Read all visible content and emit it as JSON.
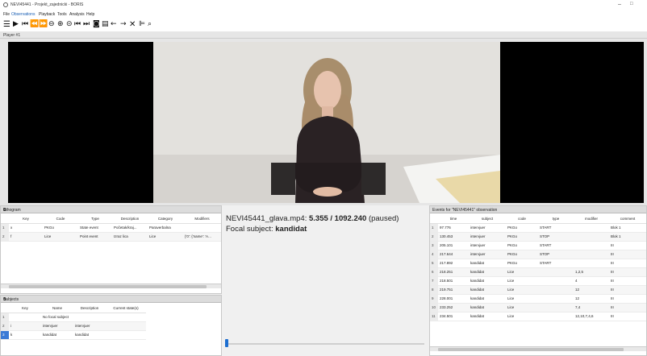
{
  "window": {
    "title": "NEVI45441 - Projekt_zajednicki - BORIS"
  },
  "menu": [
    "File",
    "Observations",
    "Playback",
    "Tools",
    "Analysis",
    "Help"
  ],
  "toolbar_icons": [
    "list-menu-icon",
    "play-icon",
    "skip-start-icon",
    "rewind-icon",
    "fast-forward-icon",
    "zoom-out-circle-icon",
    "zoom-in-circle-icon",
    "minus-circle-icon",
    "jump-back-icon",
    "jump-forward-icon",
    "camera-icon",
    "frame-icon",
    "arrow-left-icon",
    "arrow-right-icon",
    "close-x-icon",
    "align-icon",
    "search-icon"
  ],
  "player": {
    "label": "Player #1"
  },
  "ethogram": {
    "title": "Ethogram",
    "columns": [
      "Key",
      "Code",
      "Type",
      "Description",
      "Category",
      "Modifiers"
    ],
    "rows": [
      {
        "num": "1",
        "key": "x",
        "code": "PKGo",
        "type": "State event",
        "description": "Početak/kraj...",
        "category": "Paraverbalna",
        "modifiers": ""
      },
      {
        "num": "2",
        "key": "f",
        "code": "Lice",
        "type": "Point event",
        "description": "Izraz lica",
        "category": "Lice",
        "modifiers": "{'0': {'name': 'A..."
      }
    ]
  },
  "subjects": {
    "title": "Subjects",
    "columns": [
      "Key",
      "Name",
      "Description",
      "Current state(s)"
    ],
    "rows": [
      {
        "num": "1",
        "key": "",
        "name": "No focal subject",
        "description": "",
        "state": ""
      },
      {
        "num": "2",
        "key": "i",
        "name": "intervjuer",
        "description": "intervjuer",
        "state": ""
      },
      {
        "num": "3",
        "key": "k",
        "name": "kandidat",
        "description": "kandidat",
        "state": ""
      }
    ]
  },
  "info": {
    "media_prefix": "NEVI45441_glava.mp4: ",
    "time_current": "5.355 / 1092.240",
    "status": " (paused)",
    "focal_label": "Focal subject: ",
    "focal_value": "kandidat"
  },
  "playback_position": 0.005,
  "events": {
    "title": "Events for \"NEVI45441\" observation",
    "columns": [
      "time",
      "subject",
      "code",
      "type",
      "modifier",
      "comment"
    ],
    "rows": [
      {
        "num": "1",
        "time": "97.776",
        "subject": "intervjuer",
        "code": "PKGo",
        "type": "START",
        "modifier": "",
        "comment": "Blok 1"
      },
      {
        "num": "2",
        "time": "130.453",
        "subject": "intervjuer",
        "code": "PKGo",
        "type": "STOP",
        "modifier": "",
        "comment": "Blok 1"
      },
      {
        "num": "3",
        "time": "205.101",
        "subject": "intervjuer",
        "code": "PKGo",
        "type": "START",
        "modifier": "",
        "comment": "III"
      },
      {
        "num": "4",
        "time": "217.644",
        "subject": "intervjuer",
        "code": "PKGo",
        "type": "STOP",
        "modifier": "",
        "comment": "III"
      },
      {
        "num": "5",
        "time": "217.892",
        "subject": "kandidat",
        "code": "PKGo",
        "type": "START",
        "modifier": "",
        "comment": "III"
      },
      {
        "num": "6",
        "time": "218.251",
        "subject": "kandidat",
        "code": "Lice",
        "type": "",
        "modifier": "1,2,5",
        "comment": "III"
      },
      {
        "num": "7",
        "time": "218.501",
        "subject": "kandidat",
        "code": "Lice",
        "type": "",
        "modifier": "4",
        "comment": "III"
      },
      {
        "num": "8",
        "time": "219.751",
        "subject": "kandidat",
        "code": "Lice",
        "type": "",
        "modifier": "12",
        "comment": "III"
      },
      {
        "num": "9",
        "time": "228.001",
        "subject": "kandidat",
        "code": "Lice",
        "type": "",
        "modifier": "12",
        "comment": "III"
      },
      {
        "num": "10",
        "time": "233.252",
        "subject": "kandidat",
        "code": "Lice",
        "type": "",
        "modifier": "7,4",
        "comment": "III"
      },
      {
        "num": "11",
        "time": "234.501",
        "subject": "kandidat",
        "code": "Lice",
        "type": "",
        "modifier": "12,10,7,4,6",
        "comment": "III"
      }
    ]
  },
  "colors": {
    "accent": "#1e6fd0",
    "video_bg": "#000000"
  }
}
